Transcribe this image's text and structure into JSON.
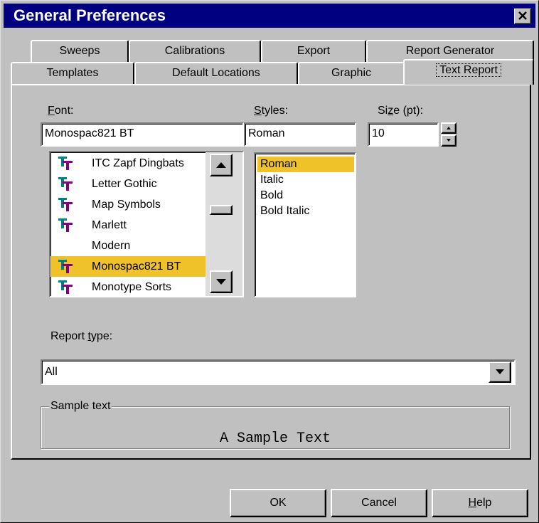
{
  "window": {
    "title": "General Preferences"
  },
  "tabs": {
    "row1": [
      {
        "label": "Sweeps"
      },
      {
        "label": "Calibrations"
      },
      {
        "label": "Export"
      },
      {
        "label": "Report Generator"
      }
    ],
    "row2": [
      {
        "label": "Templates"
      },
      {
        "label": "Default Locations"
      },
      {
        "label": "Graphic"
      },
      {
        "label": "Text Report",
        "active": true
      }
    ]
  },
  "font": {
    "label_prefix": "",
    "label_accel": "F",
    "label_rest": "ont:",
    "value": "Monospac821 BT",
    "items": [
      {
        "name": "ITC Zapf Dingbats",
        "icon": "truetype-icon"
      },
      {
        "name": "Letter Gothic",
        "icon": "truetype-icon"
      },
      {
        "name": "Map Symbols",
        "icon": "truetype-icon"
      },
      {
        "name": "Marlett",
        "icon": "truetype-icon"
      },
      {
        "name": "Modern",
        "icon": ""
      },
      {
        "name": "Monospac821 BT",
        "icon": "truetype-icon",
        "selected": true
      },
      {
        "name": "Monotype Sorts",
        "icon": "truetype-icon"
      }
    ]
  },
  "styles": {
    "label_accel": "S",
    "label_rest": "tyles:",
    "value": "Roman",
    "items": [
      {
        "name": "Roman",
        "selected": true
      },
      {
        "name": "Italic"
      },
      {
        "name": "Bold"
      },
      {
        "name": "Bold Italic"
      }
    ]
  },
  "size": {
    "label_prefix": "Si",
    "label_accel": "z",
    "label_rest": "e (pt):",
    "value": "10"
  },
  "report_type": {
    "label_prefix": "Report ",
    "label_accel": "t",
    "label_rest": "ype:",
    "value": "All"
  },
  "sample": {
    "legend": "Sample text",
    "text": "A Sample Text"
  },
  "buttons": {
    "ok": "OK",
    "cancel": "Cancel",
    "help_accel": "H",
    "help_rest": "elp"
  },
  "colors": {
    "titlebar": "#000080",
    "selection": "#f0c229",
    "truetype_icon_teal": "#008080",
    "truetype_icon_magenta": "#800080"
  }
}
